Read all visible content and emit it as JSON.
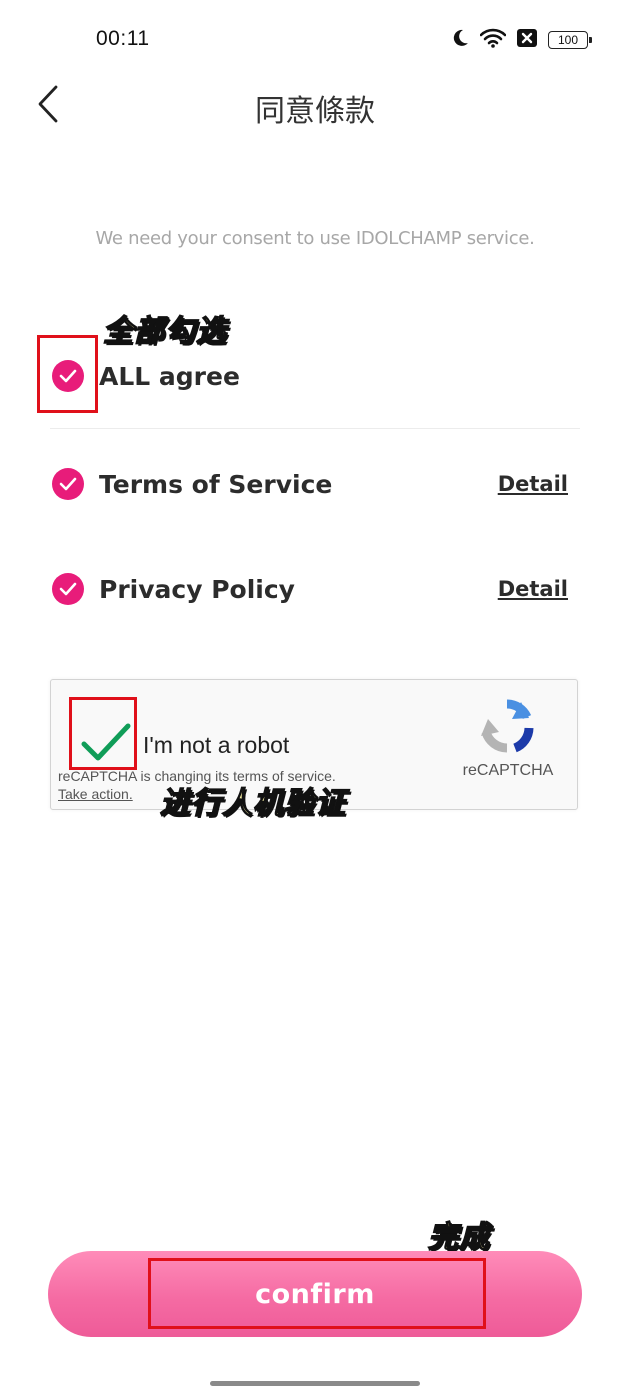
{
  "status_bar": {
    "time": "00:11",
    "battery": "100",
    "icons": [
      "moon-icon",
      "wifi-icon",
      "sim-blocked-icon",
      "battery-icon"
    ]
  },
  "header": {
    "title": "同意條款",
    "back_icon": "chevron-left-icon"
  },
  "consent_text": "We need your consent to use IDOLCHAMP service.",
  "annotations": {
    "select_all": "全部勾选",
    "verify": "进行人机验证",
    "done": "完成"
  },
  "consent_items": [
    {
      "label": "ALL agree",
      "checked": true
    },
    {
      "label": "Terms of Service",
      "checked": true,
      "detail": "Detail"
    },
    {
      "label": "Privacy Policy",
      "checked": true,
      "detail": "Detail"
    }
  ],
  "recaptcha": {
    "label": "I'm not a robot",
    "checked": true,
    "notice": "reCAPTCHA is changing its terms of service.",
    "action": "Take action.",
    "brand": "reCAPTCHA"
  },
  "confirm_label": "confirm",
  "colors": {
    "accent": "#e81c7a",
    "button": "#f56ba3",
    "check_green": "#109d58",
    "annotation_box": "#e0101a",
    "annotation_text": "#fbf3a6"
  }
}
